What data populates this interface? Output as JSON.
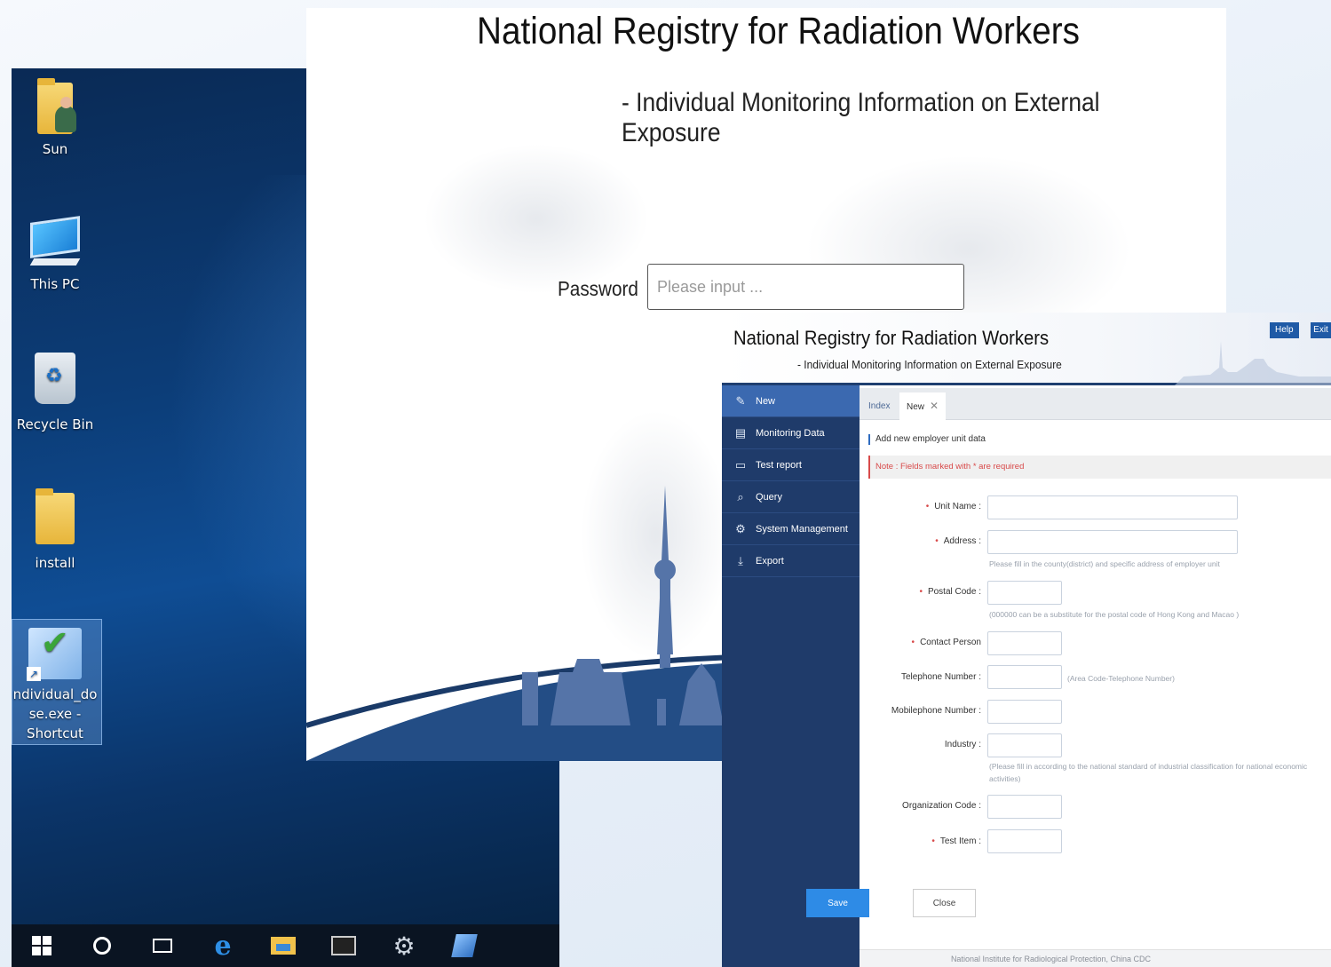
{
  "desktop": {
    "icons": [
      {
        "label": "Sun",
        "icon": "user-folder-icon"
      },
      {
        "label": "This PC",
        "icon": "this-pc-icon"
      },
      {
        "label": "Recycle Bin",
        "icon": "recycle-bin-icon"
      },
      {
        "label": "install",
        "icon": "folder-icon"
      },
      {
        "label_line1": "ndividual_do",
        "label_line2": "se.exe -",
        "label_line3": "Shortcut",
        "icon": "app-shortcut-icon"
      }
    ],
    "taskbar": [
      "start-icon",
      "cortana-icon",
      "task-view-icon",
      "edge-icon",
      "file-explorer-icon",
      "terminal-icon",
      "settings-gear-icon",
      "app-icon"
    ]
  },
  "login": {
    "title": "National Registry for Radiation Workers",
    "subtitle": "- Individual Monitoring Information on External Exposure",
    "password_label": "Password",
    "password_placeholder": "Please input ..."
  },
  "app": {
    "title": "National Registry for Radiation Workers",
    "subtitle": "- Individual Monitoring Information on External Exposure",
    "header_buttons": {
      "help": "Help",
      "exit": "Exit"
    },
    "nav": [
      {
        "label": "New",
        "icon": "edit-icon",
        "active": true
      },
      {
        "label": "Monitoring Data",
        "icon": "clipboard-icon"
      },
      {
        "label": "Test report",
        "icon": "document-icon"
      },
      {
        "label": "Query",
        "icon": "search-icon"
      },
      {
        "label": "System Management",
        "icon": "gear-icon"
      },
      {
        "label": "Export",
        "icon": "download-icon"
      }
    ],
    "tabs": {
      "index": "Index",
      "new": "New"
    },
    "section_title": "Add new employer unit data",
    "note": "Note : Fields marked with * are required",
    "fields": {
      "unit_name": "Unit Name :",
      "address": "Address :",
      "address_hint": "Please fill in the county(district) and specific address of employer unit",
      "postal_code": "Postal Code :",
      "postal_hint": "(000000 can be a substitute for the postal code of Hong Kong and Macao )",
      "contact_person": "Contact Person",
      "telephone": "Telephone Number :",
      "telephone_hint": "(Area Code-Telephone Number)",
      "mobile": "Mobilephone Number :",
      "industry": "Industry :",
      "industry_hint_1": "(Please fill in according to the national standard of industrial classification for national economic",
      "industry_hint_2": "activities)",
      "org_code": "Organization Code :",
      "test_item": "Test Item :"
    },
    "buttons": {
      "save": "Save",
      "close": "Close"
    },
    "footer": "National Institute for Radiological Protection, China CDC"
  }
}
